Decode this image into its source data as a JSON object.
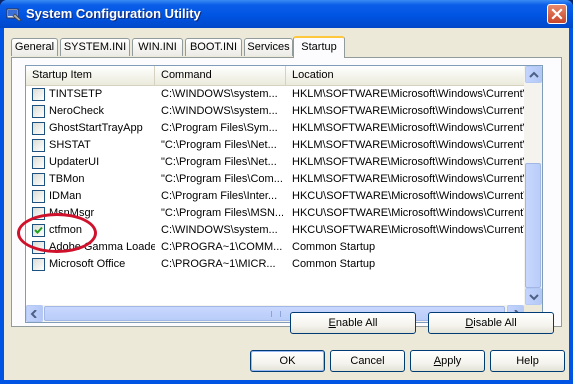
{
  "window": {
    "title": "System Configuration Utility"
  },
  "tabs": [
    {
      "label": "General"
    },
    {
      "label": "SYSTEM.INI"
    },
    {
      "label": "WIN.INI"
    },
    {
      "label": "BOOT.INI"
    },
    {
      "label": "Services"
    },
    {
      "label": "Startup",
      "active": true
    }
  ],
  "list": {
    "columns": [
      "Startup Item",
      "Command",
      "Location"
    ],
    "rows": [
      {
        "item": "TINTSETP",
        "command": "C:\\WINDOWS\\system...",
        "location": "HKLM\\SOFTWARE\\Microsoft\\Windows\\CurrentVer...",
        "checked": false
      },
      {
        "item": "NeroCheck",
        "command": "C:\\WINDOWS\\system...",
        "location": "HKLM\\SOFTWARE\\Microsoft\\Windows\\CurrentVer...",
        "checked": false
      },
      {
        "item": "GhostStartTrayApp",
        "command": "C:\\Program Files\\Sym...",
        "location": "HKLM\\SOFTWARE\\Microsoft\\Windows\\CurrentVer...",
        "checked": false
      },
      {
        "item": "SHSTAT",
        "command": "\"C:\\Program Files\\Net...",
        "location": "HKLM\\SOFTWARE\\Microsoft\\Windows\\CurrentVer...",
        "checked": false
      },
      {
        "item": "UpdaterUI",
        "command": "\"C:\\Program Files\\Net...",
        "location": "HKLM\\SOFTWARE\\Microsoft\\Windows\\CurrentVer...",
        "checked": false
      },
      {
        "item": "TBMon",
        "command": "\"C:\\Program Files\\Com...",
        "location": "HKLM\\SOFTWARE\\Microsoft\\Windows\\CurrentVer...",
        "checked": false
      },
      {
        "item": "IDMan",
        "command": "C:\\Program Files\\Inter...",
        "location": "HKCU\\SOFTWARE\\Microsoft\\Windows\\CurrentVer...",
        "checked": false
      },
      {
        "item": "MsnMsgr",
        "command": "\"C:\\Program Files\\MSN...",
        "location": "HKCU\\SOFTWARE\\Microsoft\\Windows\\CurrentVer...",
        "checked": false
      },
      {
        "item": "ctfmon",
        "command": "C:\\WINDOWS\\system...",
        "location": "HKCU\\SOFTWARE\\Microsoft\\Windows\\CurrentVer...",
        "checked": true
      },
      {
        "item": "Adobe Gamma Loader",
        "command": "C:\\PROGRA~1\\COMM...",
        "location": "Common Startup",
        "checked": false
      },
      {
        "item": "Microsoft Office",
        "command": "C:\\PROGRA~1\\MICR...",
        "location": "Common Startup",
        "checked": false
      }
    ]
  },
  "buttons": {
    "enable_all": {
      "underlined": "E",
      "rest": "nable All"
    },
    "disable_all": {
      "underlined": "D",
      "rest": "isable All"
    },
    "ok": "OK",
    "cancel": "Cancel",
    "apply": {
      "underlined": "A",
      "rest": "pply"
    },
    "help": "Help"
  },
  "colors": {
    "title_bar": "#0054e3",
    "active_tab_accent": "#ffc83c",
    "highlight_circle": "#d0112b",
    "checkmark": "#21a121"
  },
  "icons": {
    "title": "system-config-icon",
    "close": "close-icon",
    "check": "checkmark-icon"
  }
}
